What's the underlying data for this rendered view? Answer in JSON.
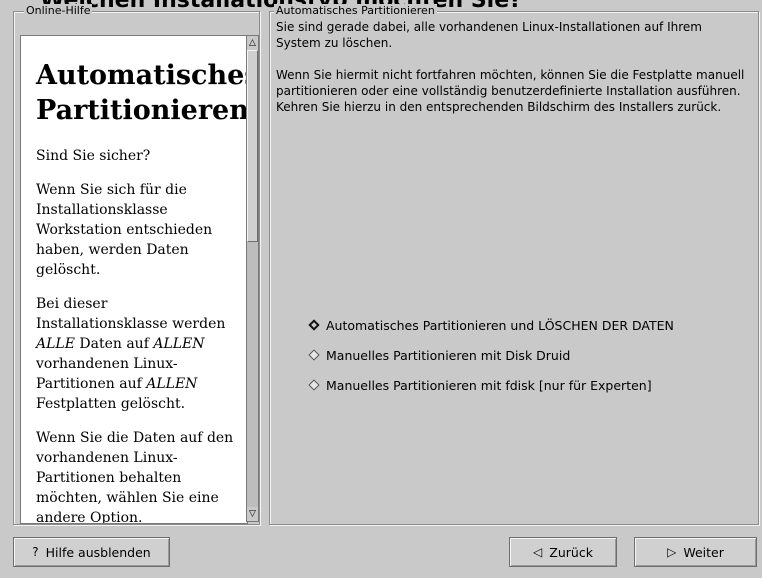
{
  "window": {
    "top_partial_text": "Welchen Installationstyp möchten Sie?"
  },
  "help_panel": {
    "legend": "Online-Hilfe",
    "title_line1": "Automatisches",
    "title_line2": "Partitionieren",
    "para1": "Sind Sie sicher?",
    "para2": "Wenn Sie sich für die Installationsklasse Workstation entschieden haben, werden Daten gelöscht.",
    "para3_a": "Bei dieser Installationsklasse werden ",
    "para3_b": "ALLE",
    "para3_c": " Daten auf ",
    "para3_d": "ALLEN",
    "para3_e": " vorhandenen Linux-Partitionen auf ",
    "para3_f": "ALLEN",
    "para3_g": " Festplatten gelöscht.",
    "para4": "Wenn Sie die Daten auf den vorhandenen Linux-Partitionen behalten möchten, wählen Sie eine andere Option."
  },
  "main_panel": {
    "legend": "Automatisches Partitionieren",
    "paragraph1": "Sie sind gerade dabei, alle vorhandenen Linux-Installationen auf Ihrem System zu löschen.",
    "paragraph2": "Wenn Sie hiermit nicht fortfahren möchten, können Sie die Festplatte manuell partitionieren oder eine vollständig benutzerdefinierte Installation ausführen. Kehren Sie hierzu in den entsprechenden Bildschirm des Installers zurück.",
    "options": [
      {
        "label": "Automatisches Partitionieren und LÖSCHEN DER DATEN",
        "selected": true
      },
      {
        "label": "Manuelles Partitionieren mit Disk Druid",
        "selected": false
      },
      {
        "label": "Manuelles Partitionieren mit fdisk [nur für Experten]",
        "selected": false
      }
    ]
  },
  "buttons": {
    "help_toggle": "Hilfe ausblenden",
    "back": "Zurück",
    "next": "Weiter"
  }
}
